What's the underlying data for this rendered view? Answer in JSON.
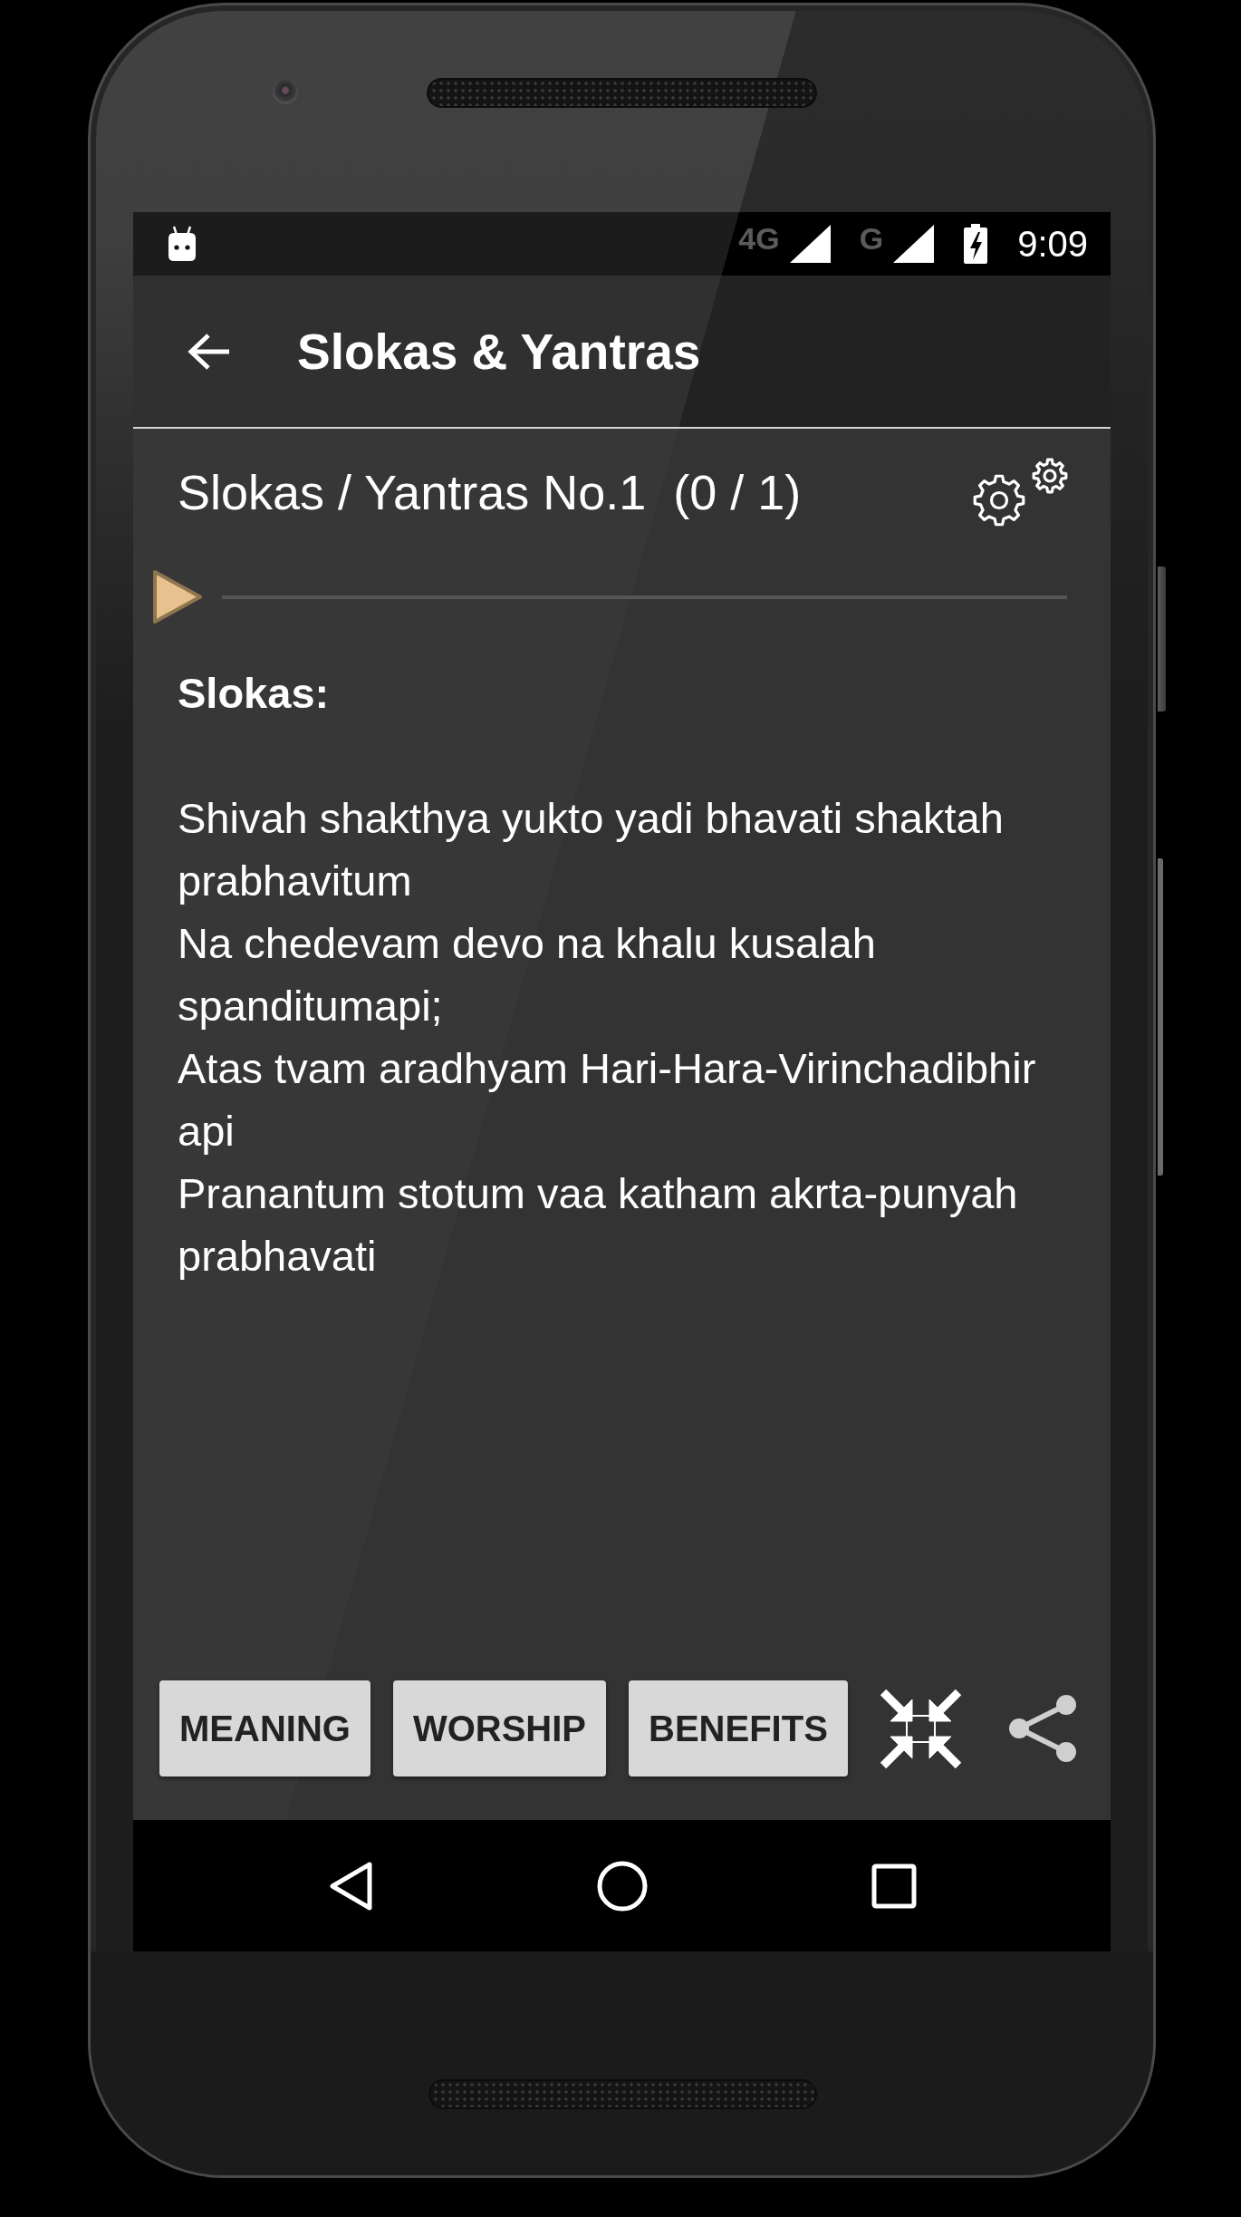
{
  "status_bar": {
    "signals": [
      {
        "label": "4G"
      },
      {
        "label": "G"
      }
    ],
    "time": "9:09"
  },
  "app_bar": {
    "title": "Slokas & Yantras"
  },
  "item": {
    "title": "Slokas / Yantras No.1  (0 / 1)"
  },
  "player": {
    "level": 0
  },
  "body": {
    "heading": "Slokas:",
    "lines": [
      "Shivah shakthya yukto yadi bhavati shaktah prabhavitum",
      "Na chedevam devo na khalu kusalah spanditumapi;",
      "Atas tvam aradhyam Hari-Hara-Virinchadibhir api",
      "Pranantum stotum vaa katham akrta-punyah prabhavati"
    ]
  },
  "actions": {
    "buttons": [
      "MEANING",
      "WORSHIP",
      "BENEFITS"
    ]
  }
}
